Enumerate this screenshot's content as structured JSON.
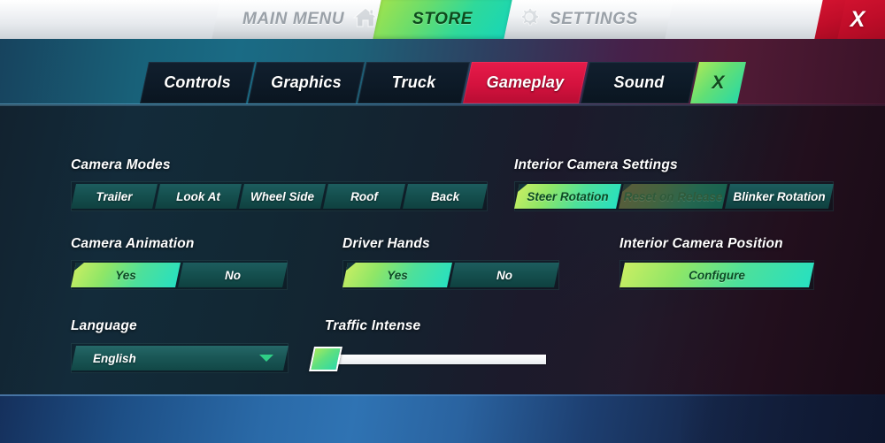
{
  "topnav": {
    "main_menu": "MAIN MENU",
    "home_icon": "home-icon",
    "store": "STORE",
    "settings": "SETTINGS",
    "gear_icon": "gear-icon",
    "close": "X"
  },
  "tabs": [
    {
      "label": "Controls",
      "active": false
    },
    {
      "label": "Graphics",
      "active": false
    },
    {
      "label": "Truck",
      "active": false
    },
    {
      "label": "Gameplay",
      "active": true
    },
    {
      "label": "Sound",
      "active": false
    },
    {
      "label": "X",
      "active": false
    }
  ],
  "sections": {
    "camera_modes": {
      "title": "Camera Modes",
      "options": [
        {
          "label": "Trailer",
          "state": "normal"
        },
        {
          "label": "Look At",
          "state": "normal"
        },
        {
          "label": "Wheel Side",
          "state": "normal"
        },
        {
          "label": "Roof",
          "state": "normal"
        },
        {
          "label": "Back",
          "state": "normal"
        }
      ]
    },
    "interior_camera_settings": {
      "title": "Interior Camera Settings",
      "options": [
        {
          "label": "Steer Rotation",
          "state": "selected"
        },
        {
          "label": "Reset on Release",
          "state": "dim"
        },
        {
          "label": "Blinker Rotation",
          "state": "normal"
        }
      ]
    },
    "camera_animation": {
      "title": "Camera Animation",
      "options": [
        {
          "label": "Yes",
          "state": "selected"
        },
        {
          "label": "No",
          "state": "normal"
        }
      ]
    },
    "driver_hands": {
      "title": "Driver Hands",
      "options": [
        {
          "label": "Yes",
          "state": "selected"
        },
        {
          "label": "No",
          "state": "normal"
        }
      ]
    },
    "interior_camera_position": {
      "title": "Interior Camera Position",
      "button_label": "Configure"
    },
    "language": {
      "title": "Language",
      "selected": "English",
      "caret_icon": "chevron-down-icon"
    },
    "traffic_intense": {
      "title": "Traffic Intense",
      "value": 0,
      "min": 0,
      "max": 100
    }
  },
  "colors": {
    "accent_green_start": "#c8ee63",
    "accent_green_end": "#27e0c0",
    "active_tab_red": "#d4123e",
    "close_red": "#c00d29",
    "teal_button": "#15504f",
    "panel_dark": "#121f2b"
  }
}
